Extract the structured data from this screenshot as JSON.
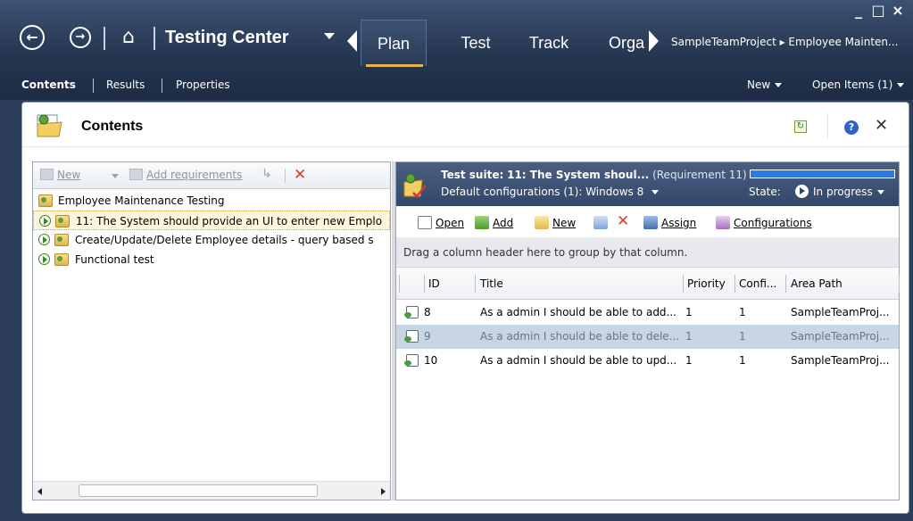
{
  "window": {
    "controls": [
      "_",
      "□",
      "×"
    ]
  },
  "nav": {
    "back_icon": "back-circle-arrow-icon",
    "forward_icon": "forward-circle-arrow-icon",
    "home_icon": "home-icon",
    "app_title": "Testing Center",
    "hub_tabs": [
      {
        "label": "Plan",
        "active": true
      },
      {
        "label": "Test",
        "active": false
      },
      {
        "label": "Track",
        "active": false
      },
      {
        "label": "Orga",
        "active": false
      }
    ],
    "breadcrumb": "SampleTeamProject ▸ Employee Mainten...",
    "accent_color": "#e3b548"
  },
  "subnav": {
    "items": [
      "Contents",
      "Results",
      "Properties"
    ],
    "new_label": "New",
    "open_items_label": "Open Items (1)"
  },
  "contents": {
    "title": "Contents",
    "toolbar": {
      "new_label": "New",
      "add_requirements_label": "Add requirements"
    },
    "tree": [
      {
        "label": "Employee Maintenance Testing",
        "level": 0
      },
      {
        "label": "11: The System should provide an UI to enter new Emplo",
        "level": 1,
        "selected": true
      },
      {
        "label": "Create/Update/Delete Employee details  -  query based s",
        "level": 1
      },
      {
        "label": "Functional test",
        "level": 1
      }
    ]
  },
  "suite": {
    "title_prefix": "Test suite:",
    "title_name": "11: The System shoul...",
    "requirement": "(Requirement 11)",
    "progress_fraction": 1.0,
    "config_label": "Default configurations (1):",
    "config_value": "Windows 8",
    "state_label": "State:",
    "state_value": "In progress",
    "toolbar": {
      "open": "Open",
      "add": "Add",
      "new": "New",
      "assign": "Assign",
      "configurations": "Configurations"
    },
    "group_hint": "Drag a column header here to group by that column.",
    "columns": [
      "ID",
      "Title",
      "Priority",
      "Confi...",
      "Area Path"
    ],
    "rows": [
      {
        "id": "8",
        "title": "As a admin I should be able to add...",
        "priority": "1",
        "config": "1",
        "area": "SampleTeamProj...",
        "selected": false
      },
      {
        "id": "9",
        "title": "As a admin I should be able to dele...",
        "priority": "1",
        "config": "1",
        "area": "SampleTeamProj...",
        "selected": true
      },
      {
        "id": "10",
        "title": "As a admin I should be able to upd...",
        "priority": "1",
        "config": "1",
        "area": "SampleTeamProj...",
        "selected": false
      }
    ]
  }
}
